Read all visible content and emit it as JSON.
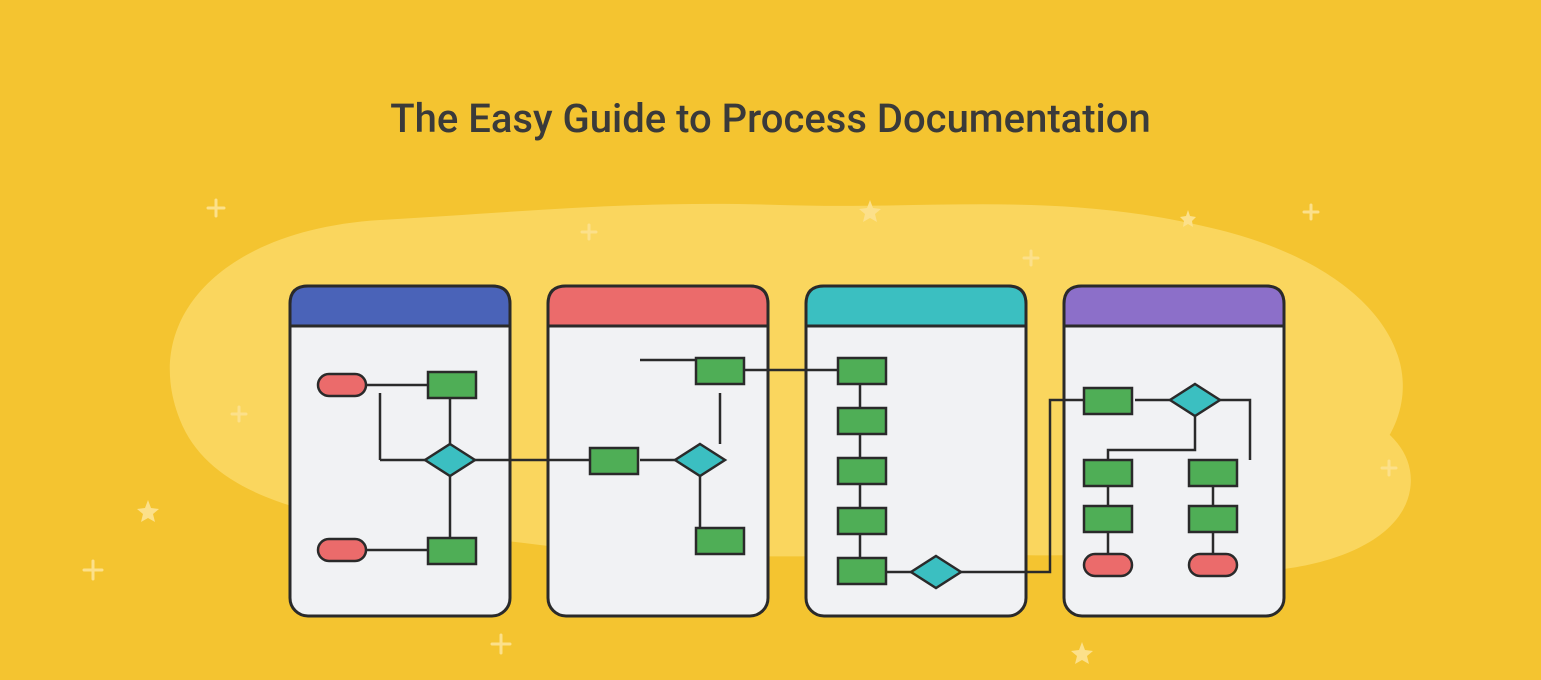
{
  "title": "The Easy Guide to Process Documentation",
  "colors": {
    "background": "#F4C430",
    "blob": "#FAD65E",
    "panelBody": "#F1F2F4",
    "panelStroke": "#2a2a2a",
    "headerBlue": "#4A63B8",
    "headerRed": "#EB6B6B",
    "headerTeal": "#3BBFC1",
    "headerPurple": "#8C6FC9",
    "processGreen": "#4FAE56",
    "terminalRed": "#EB6B6B",
    "decisionTeal": "#3BBFC1",
    "connector": "#2a2a2a",
    "sparkle": "#FCE08A"
  },
  "panels": [
    {
      "id": "panel-1",
      "header": "blue"
    },
    {
      "id": "panel-2",
      "header": "red"
    },
    {
      "id": "panel-3",
      "header": "teal"
    },
    {
      "id": "panel-4",
      "header": "purple"
    }
  ],
  "diagram": {
    "description": "Four rounded panels with flowchart shapes connected across panels",
    "nodes": [
      {
        "id": "t1",
        "type": "terminal",
        "panel": 1
      },
      {
        "id": "p1a",
        "type": "process",
        "panel": 1
      },
      {
        "id": "d1",
        "type": "decision",
        "panel": 1
      },
      {
        "id": "t2",
        "type": "terminal",
        "panel": 1
      },
      {
        "id": "p1b",
        "type": "process",
        "panel": 1
      },
      {
        "id": "p2a",
        "type": "process",
        "panel": 2
      },
      {
        "id": "p2b",
        "type": "process",
        "panel": 2
      },
      {
        "id": "d2",
        "type": "decision",
        "panel": 2
      },
      {
        "id": "p2c",
        "type": "process",
        "panel": 2
      },
      {
        "id": "p3a",
        "type": "process",
        "panel": 3
      },
      {
        "id": "p3b",
        "type": "process",
        "panel": 3
      },
      {
        "id": "p3c",
        "type": "process",
        "panel": 3
      },
      {
        "id": "p3d",
        "type": "process",
        "panel": 3
      },
      {
        "id": "p3e",
        "type": "process",
        "panel": 3
      },
      {
        "id": "d3",
        "type": "decision",
        "panel": 3
      },
      {
        "id": "p4a",
        "type": "process",
        "panel": 4
      },
      {
        "id": "d4",
        "type": "decision",
        "panel": 4
      },
      {
        "id": "p4b",
        "type": "process",
        "panel": 4
      },
      {
        "id": "p4c",
        "type": "process",
        "panel": 4
      },
      {
        "id": "p4d",
        "type": "process",
        "panel": 4
      },
      {
        "id": "p4e",
        "type": "process",
        "panel": 4
      },
      {
        "id": "t4a",
        "type": "terminal",
        "panel": 4
      },
      {
        "id": "t4b",
        "type": "terminal",
        "panel": 4
      }
    ]
  }
}
